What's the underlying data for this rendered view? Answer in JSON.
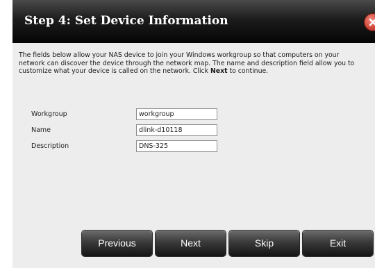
{
  "dialog": {
    "title": "Step 4: Set Device Information",
    "intro_part1": "The fields below allow your NAS device to join your Windows workgroup so that computers on your network can discover the device through the network map. The name and description field allow you to customize what your device is called on the network. Click ",
    "intro_bold": "Next",
    "intro_part2": " to continue."
  },
  "form": {
    "workgroup": {
      "label": "Workgroup",
      "value": "workgroup"
    },
    "name": {
      "label": "Name",
      "value": "dlink-d10118"
    },
    "description": {
      "label": "Description",
      "value": "DNS-325"
    }
  },
  "buttons": {
    "previous": "Previous",
    "next": "Next",
    "skip": "Skip",
    "exit": "Exit"
  },
  "icons": {
    "close": "close-icon"
  },
  "colors": {
    "titlebar": "#1c1c1c",
    "close_button": "#d24a3c",
    "content_bg": "#ededed"
  }
}
